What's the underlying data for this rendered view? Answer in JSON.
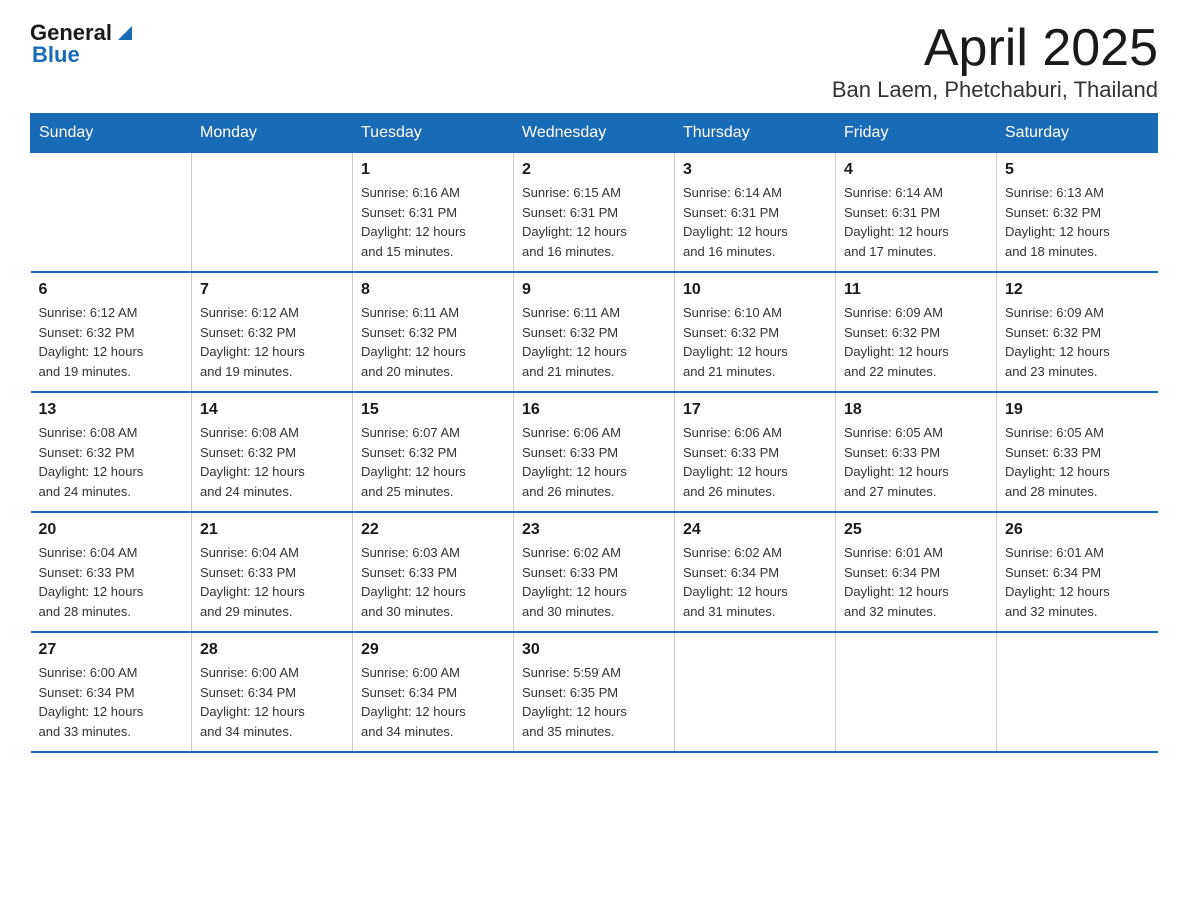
{
  "header": {
    "logo": {
      "general": "General",
      "blue": "Blue"
    },
    "title": "April 2025",
    "subtitle": "Ban Laem, Phetchaburi, Thailand"
  },
  "calendar": {
    "weekdays": [
      "Sunday",
      "Monday",
      "Tuesday",
      "Wednesday",
      "Thursday",
      "Friday",
      "Saturday"
    ],
    "weeks": [
      [
        {
          "day": "",
          "info": ""
        },
        {
          "day": "",
          "info": ""
        },
        {
          "day": "1",
          "info": "Sunrise: 6:16 AM\nSunset: 6:31 PM\nDaylight: 12 hours\nand 15 minutes."
        },
        {
          "day": "2",
          "info": "Sunrise: 6:15 AM\nSunset: 6:31 PM\nDaylight: 12 hours\nand 16 minutes."
        },
        {
          "day": "3",
          "info": "Sunrise: 6:14 AM\nSunset: 6:31 PM\nDaylight: 12 hours\nand 16 minutes."
        },
        {
          "day": "4",
          "info": "Sunrise: 6:14 AM\nSunset: 6:31 PM\nDaylight: 12 hours\nand 17 minutes."
        },
        {
          "day": "5",
          "info": "Sunrise: 6:13 AM\nSunset: 6:32 PM\nDaylight: 12 hours\nand 18 minutes."
        }
      ],
      [
        {
          "day": "6",
          "info": "Sunrise: 6:12 AM\nSunset: 6:32 PM\nDaylight: 12 hours\nand 19 minutes."
        },
        {
          "day": "7",
          "info": "Sunrise: 6:12 AM\nSunset: 6:32 PM\nDaylight: 12 hours\nand 19 minutes."
        },
        {
          "day": "8",
          "info": "Sunrise: 6:11 AM\nSunset: 6:32 PM\nDaylight: 12 hours\nand 20 minutes."
        },
        {
          "day": "9",
          "info": "Sunrise: 6:11 AM\nSunset: 6:32 PM\nDaylight: 12 hours\nand 21 minutes."
        },
        {
          "day": "10",
          "info": "Sunrise: 6:10 AM\nSunset: 6:32 PM\nDaylight: 12 hours\nand 21 minutes."
        },
        {
          "day": "11",
          "info": "Sunrise: 6:09 AM\nSunset: 6:32 PM\nDaylight: 12 hours\nand 22 minutes."
        },
        {
          "day": "12",
          "info": "Sunrise: 6:09 AM\nSunset: 6:32 PM\nDaylight: 12 hours\nand 23 minutes."
        }
      ],
      [
        {
          "day": "13",
          "info": "Sunrise: 6:08 AM\nSunset: 6:32 PM\nDaylight: 12 hours\nand 24 minutes."
        },
        {
          "day": "14",
          "info": "Sunrise: 6:08 AM\nSunset: 6:32 PM\nDaylight: 12 hours\nand 24 minutes."
        },
        {
          "day": "15",
          "info": "Sunrise: 6:07 AM\nSunset: 6:32 PM\nDaylight: 12 hours\nand 25 minutes."
        },
        {
          "day": "16",
          "info": "Sunrise: 6:06 AM\nSunset: 6:33 PM\nDaylight: 12 hours\nand 26 minutes."
        },
        {
          "day": "17",
          "info": "Sunrise: 6:06 AM\nSunset: 6:33 PM\nDaylight: 12 hours\nand 26 minutes."
        },
        {
          "day": "18",
          "info": "Sunrise: 6:05 AM\nSunset: 6:33 PM\nDaylight: 12 hours\nand 27 minutes."
        },
        {
          "day": "19",
          "info": "Sunrise: 6:05 AM\nSunset: 6:33 PM\nDaylight: 12 hours\nand 28 minutes."
        }
      ],
      [
        {
          "day": "20",
          "info": "Sunrise: 6:04 AM\nSunset: 6:33 PM\nDaylight: 12 hours\nand 28 minutes."
        },
        {
          "day": "21",
          "info": "Sunrise: 6:04 AM\nSunset: 6:33 PM\nDaylight: 12 hours\nand 29 minutes."
        },
        {
          "day": "22",
          "info": "Sunrise: 6:03 AM\nSunset: 6:33 PM\nDaylight: 12 hours\nand 30 minutes."
        },
        {
          "day": "23",
          "info": "Sunrise: 6:02 AM\nSunset: 6:33 PM\nDaylight: 12 hours\nand 30 minutes."
        },
        {
          "day": "24",
          "info": "Sunrise: 6:02 AM\nSunset: 6:34 PM\nDaylight: 12 hours\nand 31 minutes."
        },
        {
          "day": "25",
          "info": "Sunrise: 6:01 AM\nSunset: 6:34 PM\nDaylight: 12 hours\nand 32 minutes."
        },
        {
          "day": "26",
          "info": "Sunrise: 6:01 AM\nSunset: 6:34 PM\nDaylight: 12 hours\nand 32 minutes."
        }
      ],
      [
        {
          "day": "27",
          "info": "Sunrise: 6:00 AM\nSunset: 6:34 PM\nDaylight: 12 hours\nand 33 minutes."
        },
        {
          "day": "28",
          "info": "Sunrise: 6:00 AM\nSunset: 6:34 PM\nDaylight: 12 hours\nand 34 minutes."
        },
        {
          "day": "29",
          "info": "Sunrise: 6:00 AM\nSunset: 6:34 PM\nDaylight: 12 hours\nand 34 minutes."
        },
        {
          "day": "30",
          "info": "Sunrise: 5:59 AM\nSunset: 6:35 PM\nDaylight: 12 hours\nand 35 minutes."
        },
        {
          "day": "",
          "info": ""
        },
        {
          "day": "",
          "info": ""
        },
        {
          "day": "",
          "info": ""
        }
      ]
    ]
  }
}
